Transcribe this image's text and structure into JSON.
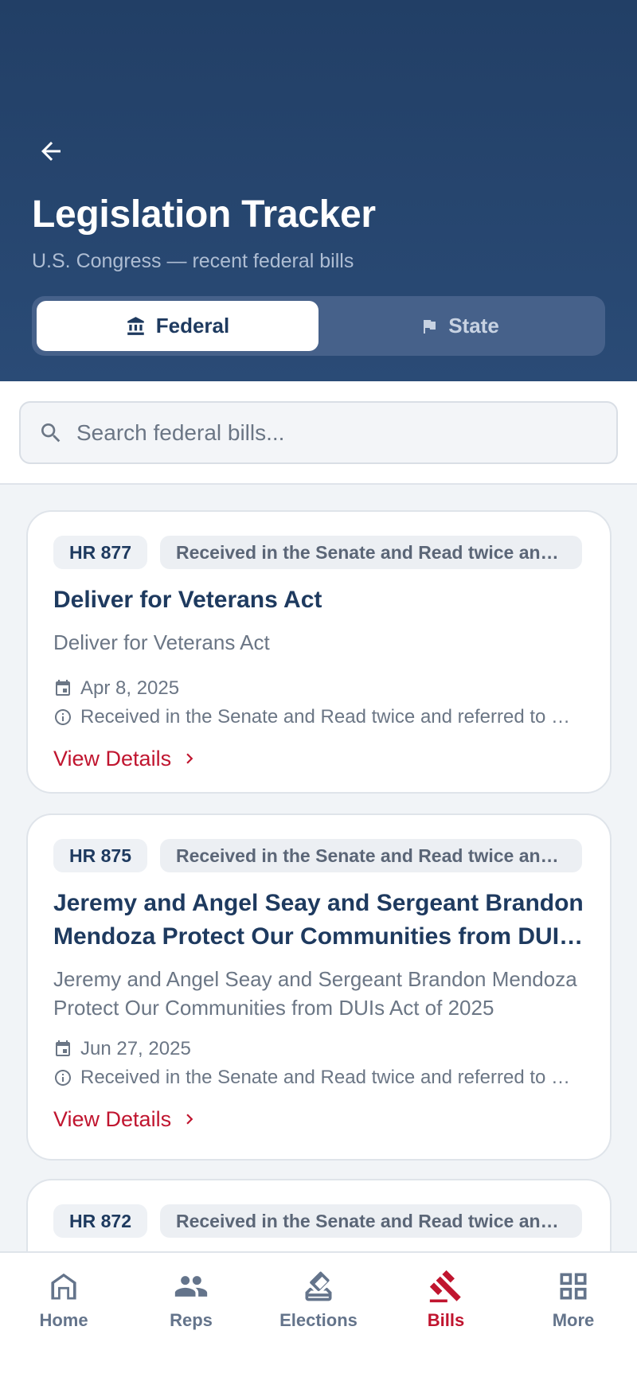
{
  "header": {
    "title": "Legislation Tracker",
    "subtitle": "U.S. Congress — recent federal bills",
    "back_icon": "arrow-left-icon"
  },
  "tabs": [
    {
      "label": "Federal",
      "icon": "bank-icon",
      "active": true
    },
    {
      "label": "State",
      "icon": "flag-icon",
      "active": false
    }
  ],
  "search": {
    "placeholder": "Search federal bills...",
    "value": ""
  },
  "bills": [
    {
      "number": "HR 877",
      "status": "Received in the Senate and Read twice and referred to the Committee",
      "title": "Deliver for Veterans Act",
      "description": "Deliver for Veterans Act",
      "date": "Apr 8, 2025",
      "latest_action": "Received in the Senate and Read twice and referred to the Committee",
      "link_label": "View Details"
    },
    {
      "number": "HR 875",
      "status": "Received in the Senate and Read twice and referred to the Committee",
      "title": "Jeremy and Angel Seay and Sergeant Brandon Mendoza Protect Our Communities from DUIs Act",
      "description": "Jeremy and Angel Seay and Sergeant Brandon Mendoza Protect Our Communities from DUIs Act of 2025",
      "date": "Jun 27, 2025",
      "latest_action": "Received in the Senate and Read twice and referred to the Committee",
      "link_label": "View Details"
    },
    {
      "number": "HR 872",
      "status": "Received in the Senate and Read twice and referred to the Committee"
    }
  ],
  "nav": [
    {
      "label": "Home",
      "icon": "home-icon",
      "active": false
    },
    {
      "label": "Reps",
      "icon": "people-icon",
      "active": false
    },
    {
      "label": "Elections",
      "icon": "ballot-icon",
      "active": false
    },
    {
      "label": "Bills",
      "icon": "gavel-icon",
      "active": true
    },
    {
      "label": "More",
      "icon": "grid-icon",
      "active": false
    }
  ],
  "colors": {
    "header_bg": "#234169",
    "accent": "#c0152f",
    "navy": "#1e3a5f"
  }
}
